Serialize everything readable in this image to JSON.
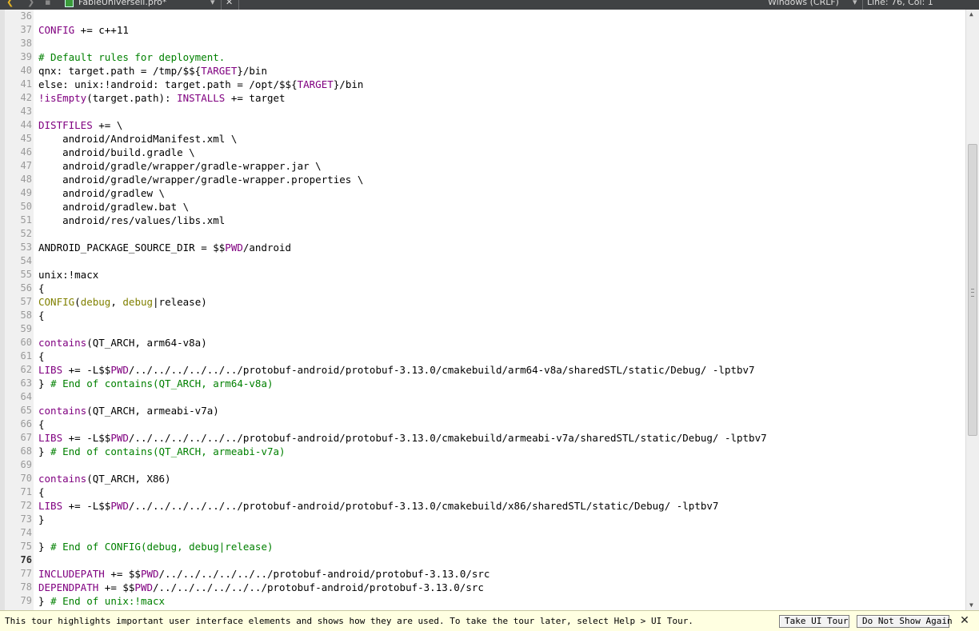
{
  "toolbar": {
    "back_glyph": "❮",
    "forward_glyph": "❯",
    "lock_glyph": "▪",
    "file_name": "FableUniversell.pro*",
    "dropdown_glyph": "▾",
    "close_glyph": "✕",
    "encoding": "Windows (CRLF)",
    "cursor_position": "Line: 76, Col: 1"
  },
  "editor": {
    "current_line": 76,
    "lines": [
      {
        "n": "36",
        "segs": [
          {
            "t": "",
            "c": "plain"
          }
        ]
      },
      {
        "n": "37",
        "segs": [
          {
            "t": "CONFIG",
            "c": "var"
          },
          {
            "t": " += c++11",
            "c": "plain"
          }
        ]
      },
      {
        "n": "38",
        "segs": [
          {
            "t": "",
            "c": "plain"
          }
        ]
      },
      {
        "n": "39",
        "segs": [
          {
            "t": "# Default rules for deployment.",
            "c": "comment"
          }
        ]
      },
      {
        "n": "40",
        "segs": [
          {
            "t": "qnx: target.path = /tmp/$${",
            "c": "plain"
          },
          {
            "t": "TARGET",
            "c": "var"
          },
          {
            "t": "}/bin",
            "c": "plain"
          }
        ]
      },
      {
        "n": "41",
        "segs": [
          {
            "t": "else: unix:!android: target.path = /opt/$${",
            "c": "plain"
          },
          {
            "t": "TARGET",
            "c": "var"
          },
          {
            "t": "}/bin",
            "c": "plain"
          }
        ]
      },
      {
        "n": "42",
        "segs": [
          {
            "t": "!isEmpty",
            "c": "var"
          },
          {
            "t": "(target.path): ",
            "c": "plain"
          },
          {
            "t": "INSTALLS",
            "c": "var"
          },
          {
            "t": " += target",
            "c": "plain"
          }
        ]
      },
      {
        "n": "43",
        "segs": [
          {
            "t": "",
            "c": "plain"
          }
        ]
      },
      {
        "n": "44",
        "segs": [
          {
            "t": "DISTFILES",
            "c": "var"
          },
          {
            "t": " += \\",
            "c": "plain"
          }
        ]
      },
      {
        "n": "45",
        "segs": [
          {
            "t": "    android/AndroidManifest.xml \\",
            "c": "plain"
          }
        ]
      },
      {
        "n": "46",
        "segs": [
          {
            "t": "    android/build.gradle \\",
            "c": "plain"
          }
        ]
      },
      {
        "n": "47",
        "segs": [
          {
            "t": "    android/gradle/wrapper/gradle-wrapper.jar \\",
            "c": "plain"
          }
        ]
      },
      {
        "n": "48",
        "segs": [
          {
            "t": "    android/gradle/wrapper/gradle-wrapper.properties \\",
            "c": "plain"
          }
        ]
      },
      {
        "n": "49",
        "segs": [
          {
            "t": "    android/gradlew \\",
            "c": "plain"
          }
        ]
      },
      {
        "n": "50",
        "segs": [
          {
            "t": "    android/gradlew.bat \\",
            "c": "plain"
          }
        ]
      },
      {
        "n": "51",
        "segs": [
          {
            "t": "    android/res/values/libs.xml",
            "c": "plain"
          }
        ]
      },
      {
        "n": "52",
        "segs": [
          {
            "t": "",
            "c": "plain"
          }
        ]
      },
      {
        "n": "53",
        "segs": [
          {
            "t": "ANDROID_PACKAGE_SOURCE_DIR = $$",
            "c": "plain"
          },
          {
            "t": "PWD",
            "c": "var"
          },
          {
            "t": "/android",
            "c": "plain"
          }
        ]
      },
      {
        "n": "54",
        "segs": [
          {
            "t": "",
            "c": "plain"
          }
        ]
      },
      {
        "n": "55",
        "segs": [
          {
            "t": "unix:!macx",
            "c": "plain"
          }
        ]
      },
      {
        "n": "56",
        "segs": [
          {
            "t": "{",
            "c": "plain"
          }
        ]
      },
      {
        "n": "57",
        "segs": [
          {
            "t": "CONFIG",
            "c": "func"
          },
          {
            "t": "(",
            "c": "plain"
          },
          {
            "t": "debug",
            "c": "func"
          },
          {
            "t": ", ",
            "c": "plain"
          },
          {
            "t": "debug",
            "c": "func"
          },
          {
            "t": "|release)",
            "c": "plain"
          }
        ]
      },
      {
        "n": "58",
        "segs": [
          {
            "t": "{",
            "c": "plain"
          }
        ]
      },
      {
        "n": "59",
        "segs": [
          {
            "t": "",
            "c": "plain"
          }
        ]
      },
      {
        "n": "60",
        "segs": [
          {
            "t": "contains",
            "c": "var"
          },
          {
            "t": "(QT_ARCH, arm64-v8a)",
            "c": "plain"
          }
        ]
      },
      {
        "n": "61",
        "segs": [
          {
            "t": "{",
            "c": "plain"
          }
        ]
      },
      {
        "n": "62",
        "segs": [
          {
            "t": "LIBS",
            "c": "var"
          },
          {
            "t": " += -L$$",
            "c": "plain"
          },
          {
            "t": "PWD",
            "c": "var"
          },
          {
            "t": "/../../../../../../protobuf-android/protobuf-3.13.0/cmakebuild/arm64-v8a/sharedSTL/static/Debug/ -lptbv7",
            "c": "plain"
          }
        ]
      },
      {
        "n": "63",
        "segs": [
          {
            "t": "} ",
            "c": "plain"
          },
          {
            "t": "# End of contains(QT_ARCH, arm64-v8a)",
            "c": "comment"
          }
        ]
      },
      {
        "n": "64",
        "segs": [
          {
            "t": "",
            "c": "plain"
          }
        ]
      },
      {
        "n": "65",
        "segs": [
          {
            "t": "contains",
            "c": "var"
          },
          {
            "t": "(QT_ARCH, armeabi-v7a)",
            "c": "plain"
          }
        ]
      },
      {
        "n": "66",
        "segs": [
          {
            "t": "{",
            "c": "plain"
          }
        ]
      },
      {
        "n": "67",
        "segs": [
          {
            "t": "LIBS",
            "c": "var"
          },
          {
            "t": " += -L$$",
            "c": "plain"
          },
          {
            "t": "PWD",
            "c": "var"
          },
          {
            "t": "/../../../../../../protobuf-android/protobuf-3.13.0/cmakebuild/armeabi-v7a/sharedSTL/static/Debug/ -lptbv7",
            "c": "plain"
          }
        ]
      },
      {
        "n": "68",
        "segs": [
          {
            "t": "} ",
            "c": "plain"
          },
          {
            "t": "# End of contains(QT_ARCH, armeabi-v7a)",
            "c": "comment"
          }
        ]
      },
      {
        "n": "69",
        "segs": [
          {
            "t": "",
            "c": "plain"
          }
        ]
      },
      {
        "n": "70",
        "segs": [
          {
            "t": "contains",
            "c": "var"
          },
          {
            "t": "(QT_ARCH, X86)",
            "c": "plain"
          }
        ]
      },
      {
        "n": "71",
        "segs": [
          {
            "t": "{",
            "c": "plain"
          }
        ]
      },
      {
        "n": "72",
        "segs": [
          {
            "t": "LIBS",
            "c": "var"
          },
          {
            "t": " += -L$$",
            "c": "plain"
          },
          {
            "t": "PWD",
            "c": "var"
          },
          {
            "t": "/../../../../../../protobuf-android/protobuf-3.13.0/cmakebuild/x86/sharedSTL/static/Debug/ -lptbv7",
            "c": "plain"
          }
        ]
      },
      {
        "n": "73",
        "segs": [
          {
            "t": "}",
            "c": "plain"
          }
        ]
      },
      {
        "n": "74",
        "segs": [
          {
            "t": "",
            "c": "plain"
          }
        ]
      },
      {
        "n": "75",
        "segs": [
          {
            "t": "} ",
            "c": "plain"
          },
          {
            "t": "# End of CONFIG(debug, debug|release)",
            "c": "comment"
          }
        ]
      },
      {
        "n": "76",
        "segs": [
          {
            "t": "",
            "c": "plain"
          }
        ]
      },
      {
        "n": "77",
        "segs": [
          {
            "t": "INCLUDEPATH",
            "c": "var"
          },
          {
            "t": " += $$",
            "c": "plain"
          },
          {
            "t": "PWD",
            "c": "var"
          },
          {
            "t": "/../../../../../../protobuf-android/protobuf-3.13.0/src",
            "c": "plain"
          }
        ]
      },
      {
        "n": "78",
        "segs": [
          {
            "t": "DEPENDPATH",
            "c": "var"
          },
          {
            "t": " += $$",
            "c": "plain"
          },
          {
            "t": "PWD",
            "c": "var"
          },
          {
            "t": "/../../../../../../protobuf-android/protobuf-3.13.0/src",
            "c": "plain"
          }
        ]
      },
      {
        "n": "79",
        "segs": [
          {
            "t": "} ",
            "c": "plain"
          },
          {
            "t": "# End of unix:!macx",
            "c": "comment"
          }
        ]
      }
    ]
  },
  "colors": {
    "comment": "#008000",
    "variable": "#800080",
    "function": "#808000",
    "plain": "#000000",
    "line_number": "#9a9a9a",
    "tour_background": "#ffffe1"
  },
  "scrollbar": {
    "up_glyph": "▲",
    "down_glyph": "▼",
    "scroll_position": 0.43
  },
  "tourbar": {
    "message": "This tour highlights important user interface elements and shows how they are used. To take the tour later, select Help > UI Tour.",
    "take_tour_label": "Take UI Tour",
    "dont_show_label": "Do Not Show Again",
    "close_glyph": "✕"
  }
}
